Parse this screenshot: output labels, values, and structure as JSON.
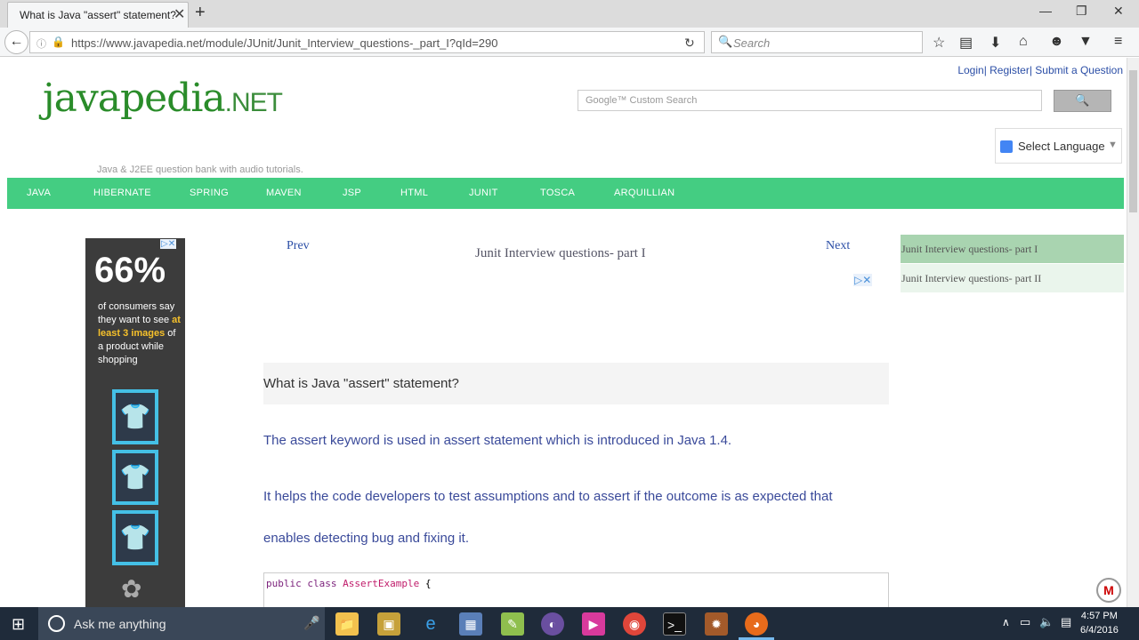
{
  "browser": {
    "tab_title": "What is Java \"assert\" statement?",
    "tab_close": "✕",
    "new_tab": "+",
    "url": "https://www.javapedia.net/module/JUnit/Junit_Interview_questions-_part_I?qId=290",
    "search_placeholder": "Search",
    "icons": [
      "back-icon",
      "info-icon",
      "lock-icon",
      "reload-icon",
      "search-icon",
      "bookmark-star-icon",
      "reading-list-icon",
      "download-icon",
      "home-icon",
      "chat-icon",
      "pocket-icon",
      "menu-icon"
    ]
  },
  "header": {
    "top_links": "Login| Register| Submit a Question",
    "logo_main": "javapedia",
    "logo_suffix": ".NET",
    "tagline": "Java & J2EE question bank with audio tutorials.",
    "search_placeholder": "Google™ Custom Search",
    "search_button": "🔍",
    "language": "Select Language",
    "language_arrow": "▼"
  },
  "menu": [
    "JAVA",
    "HIBERNATE",
    "SPRING",
    "MAVEN",
    "JSP",
    "HTML",
    "JUNIT",
    "TOSCA",
    "ARQUILLIAN"
  ],
  "ad_left": {
    "percent": "66%",
    "line1": "of consumers say they want to see ",
    "highlight1": "at least",
    "highlight2": "3 images",
    "line2": " of a product while shopping",
    "choices": "▷✕"
  },
  "content": {
    "prev": "Prev",
    "next": "Next",
    "title": "Junit Interview questions- part I",
    "question": "What is Java \"assert\" statement?",
    "answer1": "The assert keyword is used in assert statement which is introduced in Java 1.4.",
    "answer2": "It helps the code developers to test assumptions and to assert if the outcome is as expected that",
    "answer3": "enables detecting bug and fixing it.",
    "code_kw": "public class",
    "code_cls": "AssertExample",
    "code_brace": " {"
  },
  "sidebar": [
    {
      "label": "Junit Interview questions- part I",
      "active": true
    },
    {
      "label": "Junit Interview questions- part II",
      "active": false
    }
  ],
  "taskbar": {
    "search": "Ask me anything",
    "time": "4:57 PM",
    "date": "6/4/2016"
  }
}
